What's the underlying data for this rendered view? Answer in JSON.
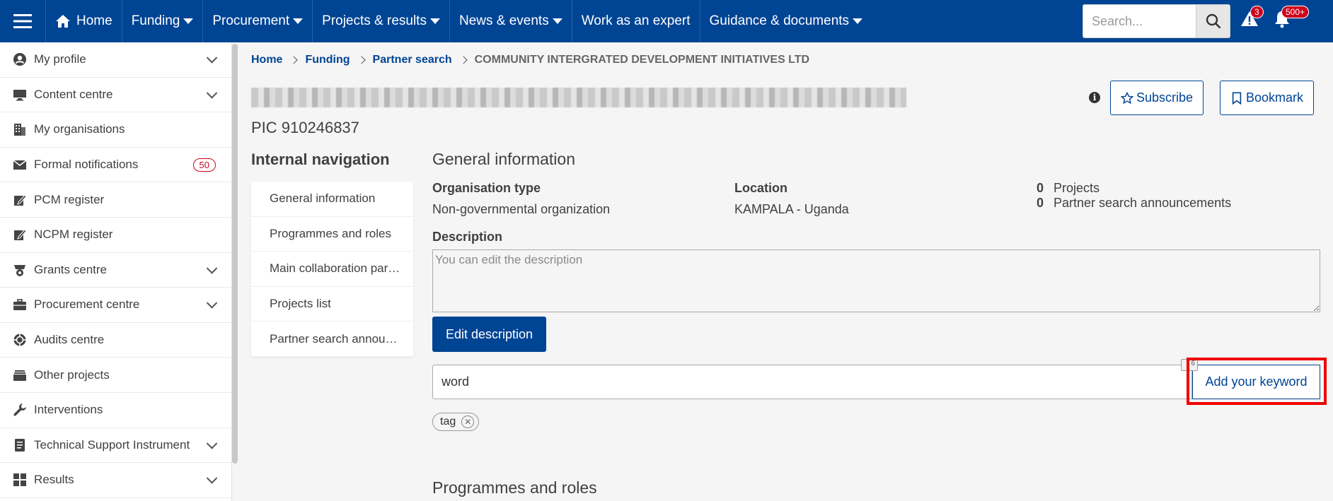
{
  "topbar": {
    "nav": [
      {
        "label": "Home"
      },
      {
        "label": "Funding"
      },
      {
        "label": "Procurement"
      },
      {
        "label": "Projects & results"
      },
      {
        "label": "News & events"
      },
      {
        "label": "Work as an expert"
      },
      {
        "label": "Guidance & documents"
      }
    ],
    "search_placeholder": "Search...",
    "alerts_count": "3",
    "notifications_count": "500+"
  },
  "sidebar": {
    "items": [
      {
        "label": "My profile",
        "icon": "user-icon"
      },
      {
        "label": "Content centre",
        "icon": "monitor-icon"
      },
      {
        "label": "My organisations",
        "icon": "building-icon"
      },
      {
        "label": "Formal notifications",
        "icon": "envelope-icon",
        "badge": "50"
      },
      {
        "label": "PCM register",
        "icon": "edit-icon"
      },
      {
        "label": "NCPM register",
        "icon": "edit-icon"
      },
      {
        "label": "Grants centre",
        "icon": "grants-icon"
      },
      {
        "label": "Procurement centre",
        "icon": "briefcase-icon"
      },
      {
        "label": "Audits centre",
        "icon": "crosshair-icon"
      },
      {
        "label": "Other projects",
        "icon": "layers-icon"
      },
      {
        "label": "Interventions",
        "icon": "wrench-icon"
      },
      {
        "label": "Technical Support Instrument",
        "icon": "document-icon"
      },
      {
        "label": "Results",
        "icon": "grid-icon"
      }
    ]
  },
  "breadcrumb": {
    "items": [
      "Home",
      "Funding",
      "Partner search"
    ],
    "current": "COMMUNITY INTERGRATED DEVELOPMENT INITIATIVES LTD"
  },
  "org": {
    "pic": "PIC 910246837"
  },
  "actions": {
    "subscribe": "Subscribe",
    "bookmark": "Bookmark"
  },
  "internal_nav": {
    "title": "Internal navigation",
    "items": [
      "General information",
      "Programmes and roles",
      "Main collaboration partners",
      "Projects list",
      "Partner search announcements"
    ]
  },
  "general": {
    "title": "General information",
    "org_type_label": "Organisation type",
    "org_type_value": "Non-governmental organization",
    "location_label": "Location",
    "location_value": "KAMPALA - Uganda",
    "projects_count": "0",
    "projects_label": "Projects",
    "psa_count": "0",
    "psa_label": "Partner search announcements",
    "description_label": "Description",
    "description_placeholder": "You can edit the description",
    "edit_button": "Edit description",
    "keyword_value": "word",
    "keyword_button": "Add your keyword",
    "keyword_counter": "6",
    "tags": [
      "tag"
    ]
  },
  "programmes": {
    "title": "Programmes and roles"
  }
}
